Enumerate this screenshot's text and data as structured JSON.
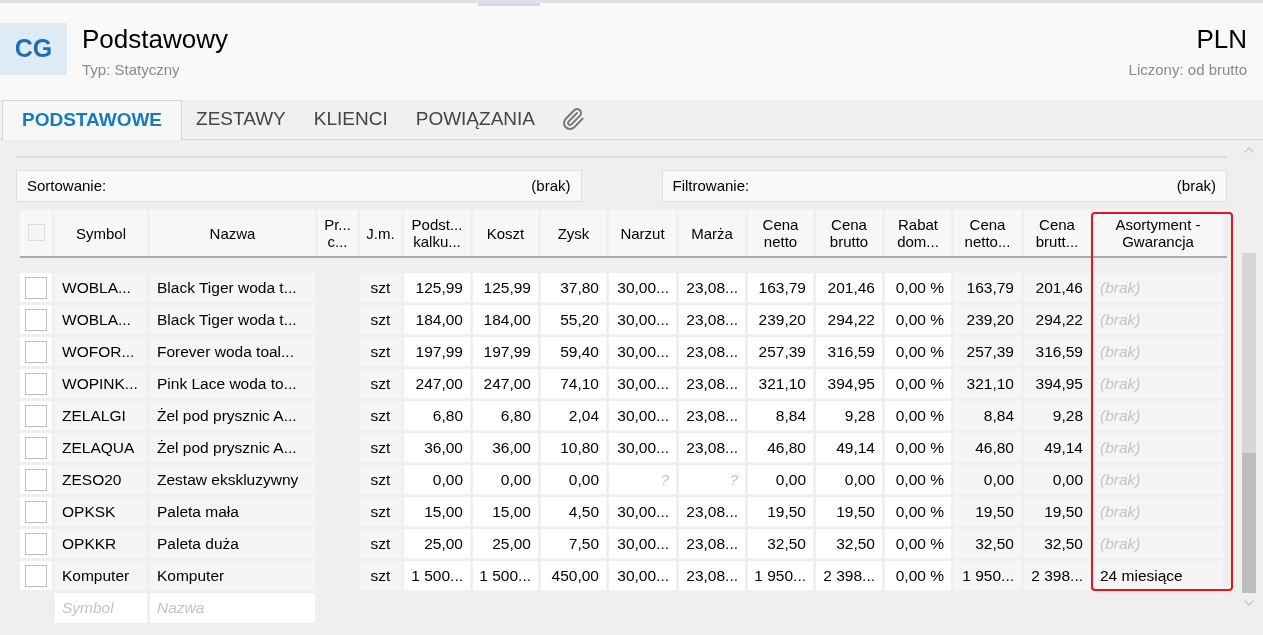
{
  "header": {
    "logo": "CG",
    "title": "Podstawowy",
    "subtitle": "Typ: Statyczny",
    "currency": "PLN",
    "calc_mode": "Liczony: od brutto"
  },
  "tabs": [
    {
      "label": "PODSTAWOWE",
      "selected": true
    },
    {
      "label": "ZESTAWY",
      "selected": false
    },
    {
      "label": "KLIENCI",
      "selected": false
    },
    {
      "label": "POWIĄZANIA",
      "selected": false
    }
  ],
  "sort": {
    "label": "Sortowanie:",
    "value": "(brak)"
  },
  "filter": {
    "label": "Filtrowanie:",
    "value": "(brak)"
  },
  "table": {
    "select_all_checked": false,
    "columns": [
      {
        "label": "Symbol",
        "highlighted": false
      },
      {
        "label": "Nazwa",
        "highlighted": false
      },
      {
        "label": "Pr... c...",
        "highlighted": false
      },
      {
        "label": "J.m.",
        "highlighted": false
      },
      {
        "label": "Podst... kalku...",
        "highlighted": false
      },
      {
        "label": "Koszt",
        "highlighted": false
      },
      {
        "label": "Zysk",
        "highlighted": false
      },
      {
        "label": "Narzut",
        "highlighted": false
      },
      {
        "label": "Marża",
        "highlighted": false
      },
      {
        "label": "Cena netto",
        "highlighted": false
      },
      {
        "label": "Cena brutto",
        "highlighted": false
      },
      {
        "label": "Rabat dom...",
        "highlighted": false
      },
      {
        "label": "Cena netto...",
        "highlighted": false
      },
      {
        "label": "Cena brutt...",
        "highlighted": false
      },
      {
        "label": "Asortyment - Gwarancja",
        "highlighted": true
      }
    ],
    "rows": [
      {
        "checked": false,
        "cells": [
          "WOBLA...",
          "Black Tiger woda t...",
          "",
          "szt",
          "125,99",
          "125,99",
          "37,80",
          "30,00...",
          "23,08...",
          "163,79",
          "201,46",
          "0,00 %",
          "163,79",
          "201,46",
          {
            "text": "(brak)",
            "empty": true
          }
        ]
      },
      {
        "checked": false,
        "cells": [
          "WOBLA...",
          "Black Tiger woda t...",
          "",
          "szt",
          "184,00",
          "184,00",
          "55,20",
          "30,00...",
          "23,08...",
          "239,20",
          "294,22",
          "0,00 %",
          "239,20",
          "294,22",
          {
            "text": "(brak)",
            "empty": true
          }
        ]
      },
      {
        "checked": false,
        "cells": [
          "WOFOR...",
          "Forever woda toal...",
          "",
          "szt",
          "197,99",
          "197,99",
          "59,40",
          "30,00...",
          "23,08...",
          "257,39",
          "316,59",
          "0,00 %",
          "257,39",
          "316,59",
          {
            "text": "(brak)",
            "empty": true
          }
        ]
      },
      {
        "checked": false,
        "cells": [
          "WOPINK...",
          "Pink Lace woda to...",
          "",
          "szt",
          "247,00",
          "247,00",
          "74,10",
          "30,00...",
          "23,08...",
          "321,10",
          "394,95",
          "0,00 %",
          "321,10",
          "394,95",
          {
            "text": "(brak)",
            "empty": true
          }
        ]
      },
      {
        "checked": false,
        "cells": [
          "ZELALGI",
          "Żel pod prysznic A...",
          "",
          "szt",
          "6,80",
          "6,80",
          "2,04",
          "30,00...",
          "23,08...",
          "8,84",
          "9,28",
          "0,00 %",
          "8,84",
          "9,28",
          {
            "text": "(brak)",
            "empty": true
          }
        ]
      },
      {
        "checked": false,
        "cells": [
          "ZELAQUA",
          "Żel pod prysznic A...",
          "",
          "szt",
          "36,00",
          "36,00",
          "10,80",
          "30,00...",
          "23,08...",
          "46,80",
          "49,14",
          "0,00 %",
          "46,80",
          "49,14",
          {
            "text": "(brak)",
            "empty": true
          }
        ]
      },
      {
        "checked": false,
        "cells": [
          "ZESO20",
          "Zestaw ekskluzywny",
          "",
          "szt",
          "0,00",
          "0,00",
          "0,00",
          {
            "text": "?",
            "empty": true
          },
          {
            "text": "?",
            "empty": true
          },
          "0,00",
          "0,00",
          "0,00 %",
          "0,00",
          "0,00",
          {
            "text": "(brak)",
            "empty": true
          }
        ]
      },
      {
        "checked": false,
        "cells": [
          "OPKSK",
          "Paleta mała",
          "",
          "szt",
          "15,00",
          "15,00",
          "4,50",
          "30,00...",
          "23,08...",
          "19,50",
          "19,50",
          "0,00 %",
          "19,50",
          "19,50",
          {
            "text": "(brak)",
            "empty": true
          }
        ]
      },
      {
        "checked": false,
        "cells": [
          "OPKKR",
          "Paleta duża",
          "",
          "szt",
          "25,00",
          "25,00",
          "7,50",
          "30,00...",
          "23,08...",
          "32,50",
          "32,50",
          "0,00 %",
          "32,50",
          "32,50",
          {
            "text": "(brak)",
            "empty": true
          }
        ]
      },
      {
        "checked": false,
        "cells": [
          "Komputer",
          "Komputer",
          "",
          "szt",
          "1 500...",
          "1 500...",
          "450,00",
          "30,00...",
          "23,08...",
          "1 950...",
          "2 398...",
          "0,00 %",
          "1 950...",
          "2 398...",
          "24 miesiące"
        ]
      }
    ],
    "new_row": {
      "symbol_placeholder": "Symbol",
      "name_placeholder": "Nazwa"
    }
  }
}
